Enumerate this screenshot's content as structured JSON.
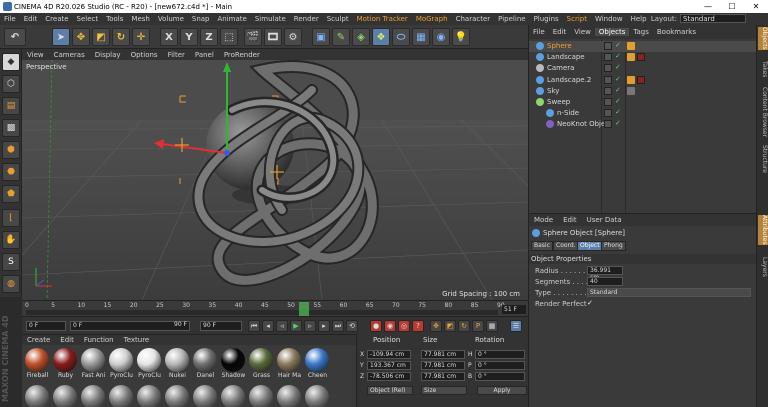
{
  "window": {
    "title": "CINEMA 4D R20.026 Studio (RC - R20) - [new672.c4d *] - Main",
    "minimize": "—",
    "maximize": "☐",
    "close": "✕"
  },
  "menubar": {
    "items": [
      "File",
      "Edit",
      "Create",
      "Select",
      "Tools",
      "Mesh",
      "Volume",
      "Snap",
      "Animate",
      "Simulate",
      "Render",
      "Sculpt",
      "Motion Tracker",
      "MoGraph",
      "Character",
      "Pipeline",
      "Plugins",
      "Script",
      "Window",
      "Help"
    ],
    "layout_label": "Layout:",
    "layout_value": "Standard"
  },
  "toolbar": {
    "undo": "↶",
    "axis_x": "X",
    "axis_y": "Y",
    "axis_z": "Z"
  },
  "viewport": {
    "menu": [
      "View",
      "Cameras",
      "Display",
      "Options",
      "Filter",
      "Panel",
      "ProRender"
    ],
    "camera_label": "Perspective",
    "grid_spacing": "Grid Spacing : 100 cm"
  },
  "timeline": {
    "ticks": [
      "0",
      "5",
      "10",
      "15",
      "20",
      "25",
      "30",
      "35",
      "40",
      "45",
      "50",
      "55",
      "60",
      "65",
      "70",
      "75",
      "80",
      "85",
      "90"
    ],
    "current_frame": 52,
    "end_label": "51 F"
  },
  "transport": {
    "start_frame": "0 F",
    "preview_start": "0 F",
    "preview_end": "90 F",
    "end_frame": "90 F"
  },
  "materials": {
    "menu": [
      "Create",
      "Edit",
      "Function",
      "Texture"
    ],
    "items": [
      {
        "name": "Fireball",
        "color": "#c0502a"
      },
      {
        "name": "Ruby",
        "color": "#8a1a1a"
      },
      {
        "name": "Fast Ani",
        "color": "#9a9a9a"
      },
      {
        "name": "PyroClu",
        "color": "#d0d0d0"
      },
      {
        "name": "PyroClu",
        "color": "#e6e6e6"
      },
      {
        "name": "Nukei",
        "color": "#b8b8b8"
      },
      {
        "name": "Danel",
        "color": "#707070"
      },
      {
        "name": "Shadow",
        "color": "#050505"
      },
      {
        "name": "Grass",
        "color": "#5a6b3a"
      },
      {
        "name": "Hair Ma",
        "color": "#8a7a60"
      },
      {
        "name": "Cheen",
        "color": "#3a78c8"
      }
    ]
  },
  "coords": {
    "headers": [
      "Position",
      "Size",
      "Rotation"
    ],
    "rows": [
      {
        "axis": "X",
        "pos": "-109.94 cm",
        "size": "77.981 cm",
        "rot_axis": "H",
        "rot": "0 °"
      },
      {
        "axis": "Y",
        "pos": "193.367 cm",
        "size": "77.981 cm",
        "rot_axis": "P",
        "rot": "0 °"
      },
      {
        "axis": "Z",
        "pos": "-78.506 cm",
        "size": "77.981 cm",
        "rot_axis": "B",
        "rot": "0 °"
      }
    ],
    "mode": "Object (Rel)",
    "size_mode": "Size",
    "apply": "Apply"
  },
  "objects": {
    "menu": [
      "File",
      "Edit",
      "View",
      "Objects",
      "Tags",
      "Bookmarks"
    ],
    "active_tab": "Objects",
    "items": [
      {
        "name": "Sphere",
        "selected": true,
        "icon": "sphere-icon",
        "indent": 0
      },
      {
        "name": "Landscape",
        "selected": false,
        "icon": "landscape-icon",
        "indent": 0
      },
      {
        "name": "Camera",
        "selected": false,
        "icon": "camera-icon",
        "indent": 0
      },
      {
        "name": "Landscape.2",
        "selected": false,
        "icon": "landscape-icon",
        "indent": 0
      },
      {
        "name": "Sky",
        "selected": false,
        "icon": "sky-icon",
        "indent": 0
      },
      {
        "name": "Sweep",
        "selected": false,
        "icon": "sweep-icon",
        "indent": 0
      },
      {
        "name": "n-Side",
        "selected": false,
        "icon": "nside-icon",
        "indent": 1
      },
      {
        "name": "NeoKnot Object",
        "selected": false,
        "icon": "neoknot-icon",
        "indent": 1
      }
    ]
  },
  "attributes": {
    "menu": [
      "Mode",
      "Edit",
      "User Data"
    ],
    "title": "Sphere Object [Sphere]",
    "tabs": [
      "Basic",
      "Coord.",
      "Object",
      "Phong"
    ],
    "active_tab": "Object",
    "section": "Object Properties",
    "props": [
      {
        "label": "Radius . . . . . . .",
        "value": "36.991 cm"
      },
      {
        "label": "Segments . . . .",
        "value": "40"
      },
      {
        "label": "Type . . . . . . . .",
        "value": "Standard"
      },
      {
        "label": "Render Perfect",
        "value": "✓"
      }
    ]
  },
  "vtabs": [
    "Objects",
    "Takes",
    "Content Browser",
    "Structure",
    "Attributes",
    "Layers"
  ],
  "colors": {
    "accent": "#5b7fa8",
    "highlight": "#f0a030"
  }
}
